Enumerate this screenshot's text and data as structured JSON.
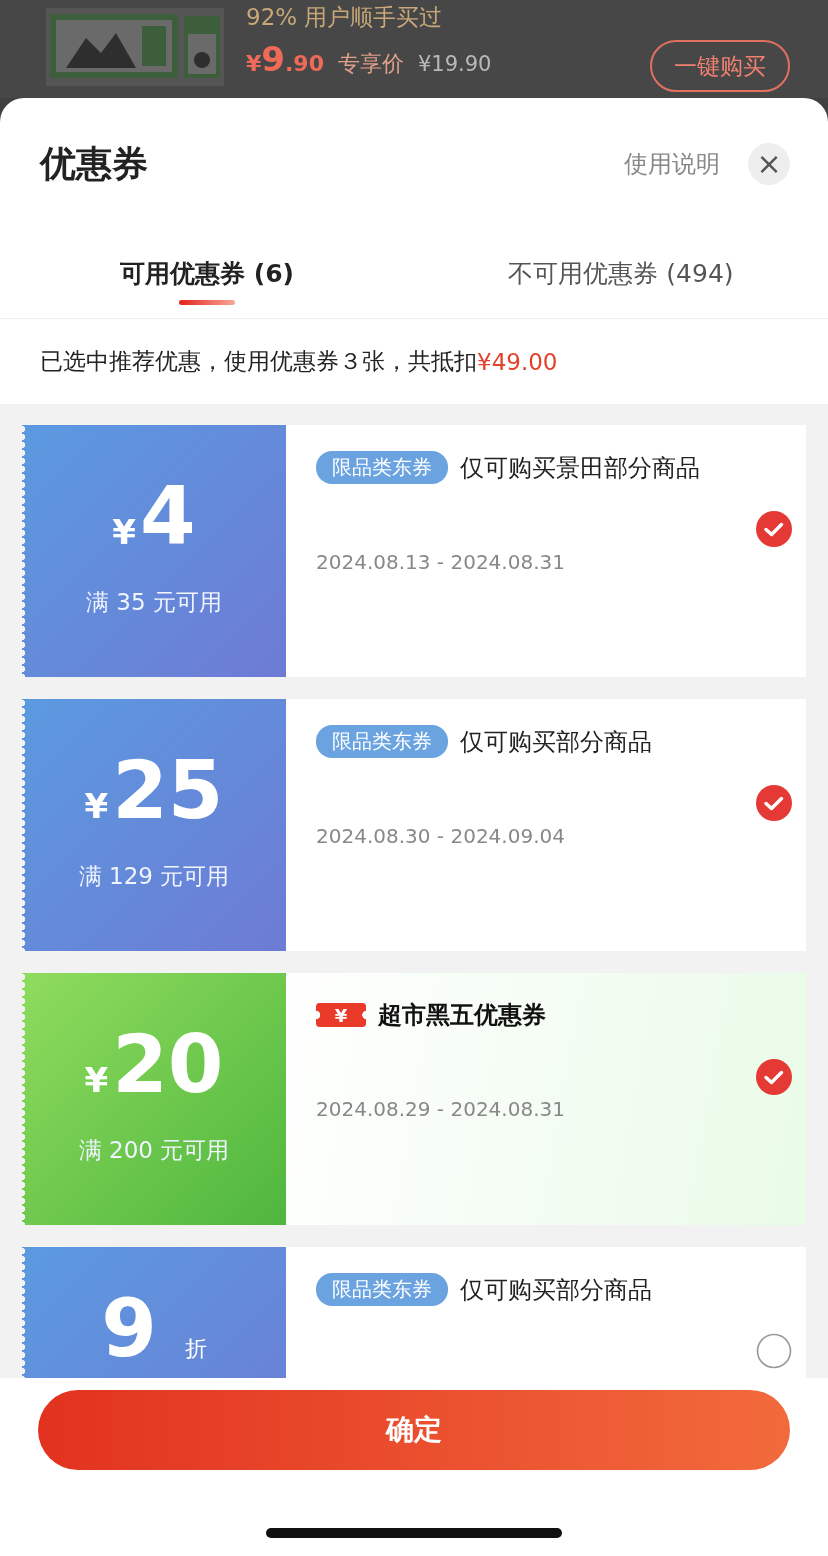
{
  "product": {
    "note": "92% 用户顺手买过",
    "price": {
      "currency": "¥",
      "integer": "9",
      "decimal": ".90"
    },
    "price_label": "专享价",
    "original_price": "¥19.90",
    "buy_button": "一键购买"
  },
  "sheet": {
    "title": "优惠券",
    "help_link": "使用说明",
    "close": "×"
  },
  "tabs": [
    {
      "label": "可用优惠券 (6)",
      "selected": true
    },
    {
      "label": "不可用优惠券 (494)",
      "selected": false
    }
  ],
  "summary": {
    "text": "已选中推荐优惠，使用优惠券３张，共抵扣",
    "amount": "¥49.00"
  },
  "coupons": [
    {
      "kind": "amount",
      "currency": "¥",
      "value": "4",
      "condition": "满 35 元可用",
      "badge": {
        "kind": "tag",
        "label": "限品类东券"
      },
      "title": "仅可购买景田部分商品",
      "dates": "2024.08.13 - 2024.08.31",
      "checked": true
    },
    {
      "kind": "amount",
      "currency": "¥",
      "value": "25",
      "condition": "满 129 元可用",
      "badge": {
        "kind": "tag",
        "label": "限品类东券"
      },
      "title": "仅可购买部分商品",
      "dates": "2024.08.30 - 2024.09.04",
      "checked": true
    },
    {
      "kind": "amount",
      "currency": "¥",
      "value": "20",
      "condition": "满 200 元可用",
      "badge": {
        "kind": "ticket",
        "label": "¥"
      },
      "title": "超市黑五优惠券",
      "dates": "2024.08.29 - 2024.08.31",
      "checked": true
    },
    {
      "kind": "discount",
      "value": "9",
      "unit": "折",
      "badge": {
        "kind": "tag",
        "label": "限品类东券"
      },
      "title": "仅可购买部分商品",
      "checked": false
    }
  ],
  "confirm_button": "确定"
}
